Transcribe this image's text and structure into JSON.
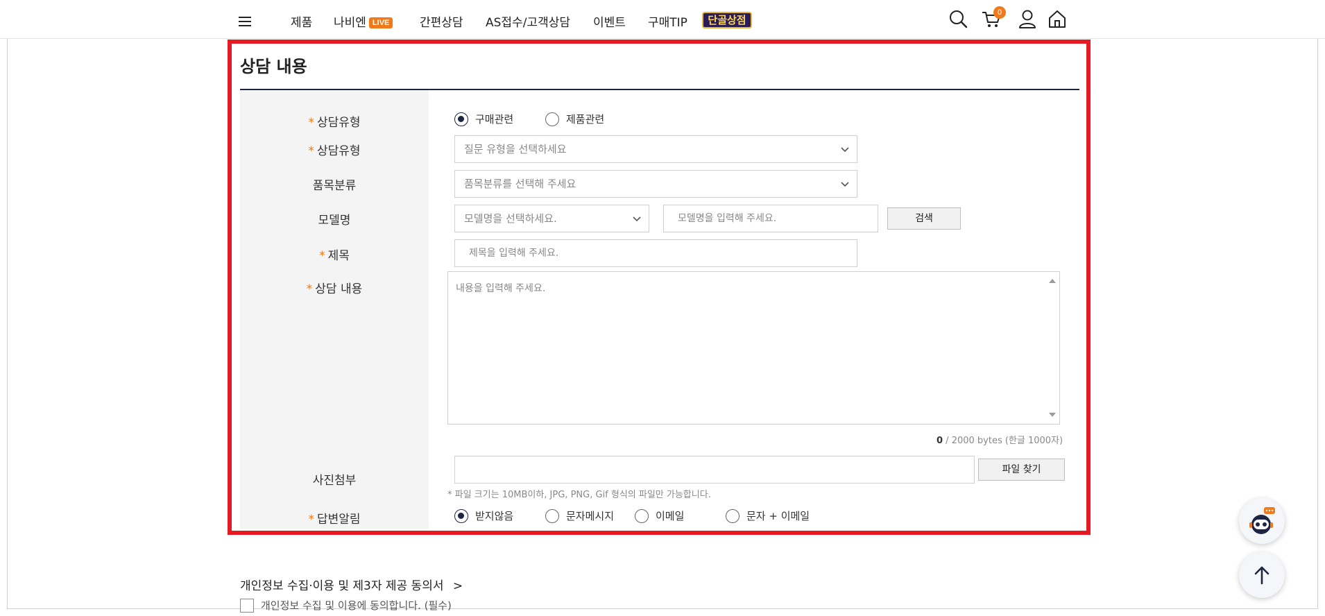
{
  "nav": {
    "items": [
      "제품",
      "나비엔",
      "간편상담",
      "AS접수/고객상담",
      "이벤트",
      "구매TIP"
    ],
    "live_badge": "LIVE",
    "store_badge": "단골상점",
    "cart_count": "0"
  },
  "form": {
    "title": "상담 내용",
    "required_mark": "*",
    "consult_type_label": "상담유형",
    "consult_type_options": [
      "구매관련",
      "제품관련"
    ],
    "consult_type_selected": "구매관련",
    "question_type_label": "상담유형",
    "question_type_placeholder": "질문 유형을 선택하세요",
    "category_label": "품목분류",
    "category_placeholder": "품목분류를 선택해 주세요",
    "model_label": "모델명",
    "model_select_placeholder": "모델명을 선택하세요.",
    "model_input_placeholder": "모델명을 입력해 주세요.",
    "search_button": "검색",
    "subject_label": "제목",
    "subject_placeholder": "제목을 입력해 주세요.",
    "content_label": "상담 내용",
    "content_placeholder": "내용을 입력해 주세요.",
    "counter_value": "0",
    "counter_text": " / 2000 bytes (한글 1000자)",
    "photo_label": "사진첨부",
    "file_button": "파일 찾기",
    "file_note": "* 파일 크기는 10MB이하, JPG, PNG, Gif 형식의 파일만 가능합니다.",
    "reply_label": "답변알림",
    "reply_options": [
      "받지않음",
      "문자메시지",
      "이메일",
      "문자 + 이메일"
    ],
    "reply_selected": "받지않음"
  },
  "privacy": {
    "title": "개인정보 수집·이용 및 제3자 제공 동의서",
    "chevron": ">",
    "agree_text": "개인정보 수집 및 이용에 동의합니다. (필수)"
  },
  "colors": {
    "accent": "#f07a1a",
    "navy": "#1c2542",
    "highlight": "#e51b24"
  }
}
